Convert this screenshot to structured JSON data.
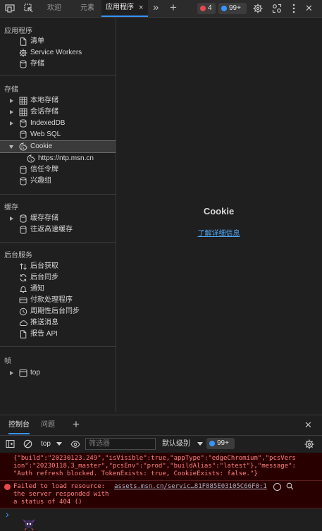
{
  "topbar": {
    "tabs": [
      "欢迎",
      "元素",
      "应用程序"
    ],
    "active_tab": "应用程序",
    "tab_close_glyph": "×",
    "more_glyph": "»",
    "add_glyph": "+",
    "errors_count": "4",
    "messages_count": "99+",
    "close_glyph": "✕",
    "icons": [
      "device-emulation-icon",
      "inspect-icon",
      "chevron-double-right-icon",
      "plus-icon",
      "error-circle-icon",
      "message-icon",
      "gear-icon",
      "connections-icon",
      "more-vertical-icon",
      "close-icon"
    ]
  },
  "sidebar": {
    "sections": {
      "application": "应用程序",
      "storage": "存储",
      "cache": "缓存",
      "background": "后台服务",
      "frames": "帧"
    },
    "application_items": [
      "清单",
      "Service Workers",
      "存储"
    ],
    "storage_items": [
      "本地存储",
      "会话存储",
      "IndexedDB",
      "Web SQL",
      "Cookie",
      "https://ntp.msn.cn",
      "信任令牌",
      "兴趣组"
    ],
    "cache_items": [
      "缓存存储",
      "往返高速缓存"
    ],
    "background_items": [
      "后台获取",
      "后台同步",
      "通知",
      "付款处理程序",
      "周期性后台同步",
      "推送消息",
      "报告 API"
    ],
    "frame_items": [
      "top"
    ],
    "selected_item": "Cookie"
  },
  "main": {
    "title": "Cookie",
    "link": "了解详细信息"
  },
  "drawer": {
    "tabs": [
      "控制台",
      "问题"
    ],
    "add_glyph": "+",
    "close_glyph": "✕",
    "context": "top",
    "filter_placeholder": "筛选器",
    "level": "默认级别",
    "issues_count": "99+",
    "log": {
      "json_line1": "{\"build\":\"20230123.249\",\"isVisible\":true,\"appType\":\"edgeChromium\",\"pcsVers",
      "json_line2": "ion\":\"20230118.3_master\",\"pcsEnv\":\"prod\",\"buildAlias\":\"latest\"},\"message\":",
      "json_line3": "\"Auth refresh blocked. TokenExists: true, CookieExists: false.\"}",
      "error_line1": "Failed to load resource:",
      "error_line2": "the server responded with",
      "error_line3": "a status of 404 ()",
      "error_source": "assets.msn.cn/servic…81F885E03105C66F0:1"
    },
    "prompt_glyph": "›"
  },
  "colors": {
    "accent": "#3794ff",
    "link": "#4ea6f5",
    "error_text": "#ff8080",
    "error_bg": "#290000",
    "error_badge": "#e5484d"
  }
}
